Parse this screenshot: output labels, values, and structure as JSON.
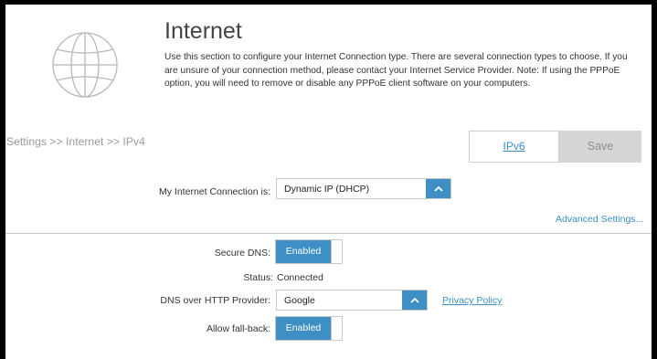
{
  "header": {
    "title": "Internet",
    "description": "Use this section to configure your Internet Connection type. There are several connection types to choose. If you are unsure of your connection method, please contact your Internet Service Provider. Note: If using the PPPoE option, you will need to remove or disable any PPPoE client software on your computers.",
    "icon": "globe-icon"
  },
  "breadcrumb": "Settings >> Internet >> IPv4",
  "toolbar": {
    "ipv6_label": "IPv6",
    "save_label": "Save"
  },
  "connection": {
    "label": "My Internet Connection is:",
    "value": "Dynamic IP (DHCP)"
  },
  "advanced_link": "Advanced Settings...",
  "dns": {
    "secure_label": "Secure DNS:",
    "secure_value": "Enabled",
    "status_label": "Status:",
    "status_value": "Connected",
    "provider_label": "DNS over HTTP Provider:",
    "provider_value": "Google",
    "privacy_link": "Privacy Policy",
    "fallback_label": "Allow fall-back:",
    "fallback_value": "Enabled"
  },
  "colors": {
    "accent": "#3d8fc6",
    "link": "#3b8fc4",
    "save_bg": "#d6d6d6"
  }
}
